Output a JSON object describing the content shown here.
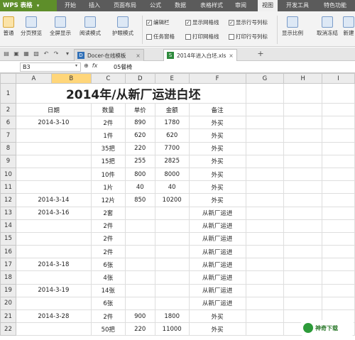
{
  "menubar": {
    "logo": "WPS 表格",
    "tabs": [
      "开始",
      "插入",
      "页面布局",
      "公式",
      "数据",
      "表格样式",
      "审阅",
      "视图",
      "开发工具",
      "特色功能"
    ]
  },
  "ribbon": {
    "buttons": [
      "普通",
      "分页预览",
      "全屏显示",
      "阅读模式",
      "护眼模式",
      "显示比例",
      "取消冻结",
      "新建"
    ],
    "checks": [
      {
        "label": "编辑栏",
        "checked": true
      },
      {
        "label": "显示网格线",
        "checked": true
      },
      {
        "label": "显示行号列标",
        "checked": true
      },
      {
        "label": "任务窗格",
        "checked": false
      },
      {
        "label": "打印网格线",
        "checked": false
      },
      {
        "label": "打印行号列标",
        "checked": false
      }
    ]
  },
  "tabs": {
    "doc1": "Docer-在线模板",
    "doc2": "2014年进入白坯.xls",
    "new": "+"
  },
  "formula": {
    "cell": "B3",
    "value": "05餐椅"
  },
  "sheet": {
    "columns": [
      "A",
      "B",
      "C",
      "D",
      "E",
      "F",
      "G",
      "H",
      "I"
    ],
    "title": "2014年/从新厂运进白坯",
    "headers": {
      "row": "2",
      "date": "日期",
      "qty": "数量",
      "price": "单价",
      "amount": "金额",
      "note": "备注"
    },
    "rows": [
      {
        "n": "6",
        "date": "2014-3-10",
        "qty": "2件",
        "price": "890",
        "amount": "1780",
        "note": "外买"
      },
      {
        "n": "7",
        "date": "",
        "qty": "1件",
        "price": "620",
        "amount": "620",
        "note": "外买"
      },
      {
        "n": "8",
        "date": "",
        "qty": "35把",
        "price": "220",
        "amount": "7700",
        "note": "外买"
      },
      {
        "n": "9",
        "date": "",
        "qty": "15把",
        "price": "255",
        "amount": "2825",
        "note": "外买"
      },
      {
        "n": "10",
        "date": "",
        "qty": "10件",
        "price": "800",
        "amount": "8000",
        "note": "外买"
      },
      {
        "n": "11",
        "date": "",
        "qty": "1片",
        "price": "40",
        "amount": "40",
        "note": "外买"
      },
      {
        "n": "12",
        "date": "2014-3-14",
        "qty": "12片",
        "price": "850",
        "amount": "10200",
        "note": "外买"
      },
      {
        "n": "13",
        "date": "2014-3-16",
        "qty": "2套",
        "price": "",
        "amount": "",
        "note": "从新厂运进"
      },
      {
        "n": "14",
        "date": "",
        "qty": "2件",
        "price": "",
        "amount": "",
        "note": "从新厂运进"
      },
      {
        "n": "15",
        "date": "",
        "qty": "2件",
        "price": "",
        "amount": "",
        "note": "从新厂运进"
      },
      {
        "n": "16",
        "date": "",
        "qty": "2件",
        "price": "",
        "amount": "",
        "note": "从新厂运进"
      },
      {
        "n": "17",
        "date": "2014-3-18",
        "qty": "6张",
        "price": "",
        "amount": "",
        "note": "从新厂运进"
      },
      {
        "n": "18",
        "date": "",
        "qty": "4张",
        "price": "",
        "amount": "",
        "note": "从新厂运进"
      },
      {
        "n": "19",
        "date": "2014-3-19",
        "qty": "14张",
        "price": "",
        "amount": "",
        "note": "从新厂运进"
      },
      {
        "n": "20",
        "date": "",
        "qty": "6张",
        "price": "",
        "amount": "",
        "note": "从新厂运进"
      },
      {
        "n": "21",
        "date": "2014-3-28",
        "qty": "2件",
        "price": "900",
        "amount": "1800",
        "note": "外买"
      },
      {
        "n": "22",
        "date": "",
        "qty": "50把",
        "price": "220",
        "amount": "11000",
        "note": "外买"
      }
    ]
  },
  "watermark": "神奇下载",
  "colors": {
    "menubar": "#5b5b5b",
    "logo": "#5e8e2a",
    "selected_col": "#ffd67a"
  }
}
